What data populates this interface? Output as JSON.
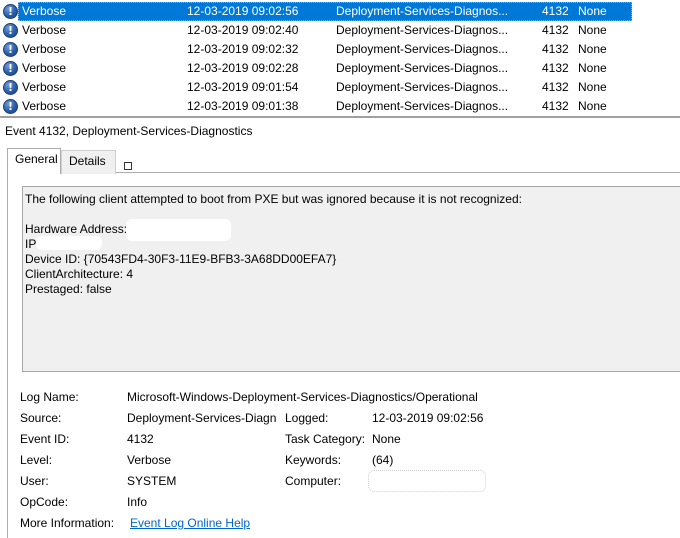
{
  "event_list": {
    "rows": [
      {
        "level": "Verbose",
        "date": "12-03-2019 09:02:56",
        "source": "Deployment-Services-Diagnos...",
        "event_id": "4132",
        "task": "None"
      },
      {
        "level": "Verbose",
        "date": "12-03-2019 09:02:40",
        "source": "Deployment-Services-Diagnos...",
        "event_id": "4132",
        "task": "None"
      },
      {
        "level": "Verbose",
        "date": "12-03-2019 09:02:32",
        "source": "Deployment-Services-Diagnos...",
        "event_id": "4132",
        "task": "None"
      },
      {
        "level": "Verbose",
        "date": "12-03-2019 09:02:28",
        "source": "Deployment-Services-Diagnos...",
        "event_id": "4132",
        "task": "None"
      },
      {
        "level": "Verbose",
        "date": "12-03-2019 09:01:54",
        "source": "Deployment-Services-Diagnos...",
        "event_id": "4132",
        "task": "None"
      },
      {
        "level": "Verbose",
        "date": "12-03-2019 09:01:38",
        "source": "Deployment-Services-Diagnos...",
        "event_id": "4132",
        "task": "None"
      }
    ],
    "icon": "info-icon",
    "icon_glyph": "!",
    "selected_color": "#0078d7"
  },
  "detail": {
    "title": "Event 4132, Deployment-Services-Diagnostics",
    "tabs": [
      "General",
      "Details"
    ],
    "message": {
      "line1": "The following client attempted to boot from PXE but was ignored because it is not recognized:",
      "hardware_address": "Hardware Address: ",
      "ip": "IP: ",
      "device_id": "Device ID: {70543FD4-30F3-11E9-BFB3-3A68DD00EFA7}",
      "client_arch": "ClientArchitecture: 4",
      "prestaged": "Prestaged: false"
    },
    "props": {
      "log_name_label": "Log Name:",
      "log_name_value": "Microsoft-Windows-Deployment-Services-Diagnostics/Operational",
      "source_label": "Source:",
      "source_value": "Deployment-Services-Diagn",
      "logged_label": "Logged:",
      "logged_value": "12-03-2019 09:02:56",
      "event_id_label": "Event ID:",
      "event_id_value": "4132",
      "task_category_label": "Task Category:",
      "task_category_value": "None",
      "level_label": "Level:",
      "level_value": "Verbose",
      "keywords_label": "Keywords:",
      "keywords_value": "(64)",
      "user_label": "User:",
      "user_value": "SYSTEM",
      "computer_label": "Computer:",
      "opcode_label": "OpCode:",
      "opcode_value": "Info",
      "more_info_label": "More Information:",
      "more_info_link": "Event Log Online Help"
    }
  }
}
